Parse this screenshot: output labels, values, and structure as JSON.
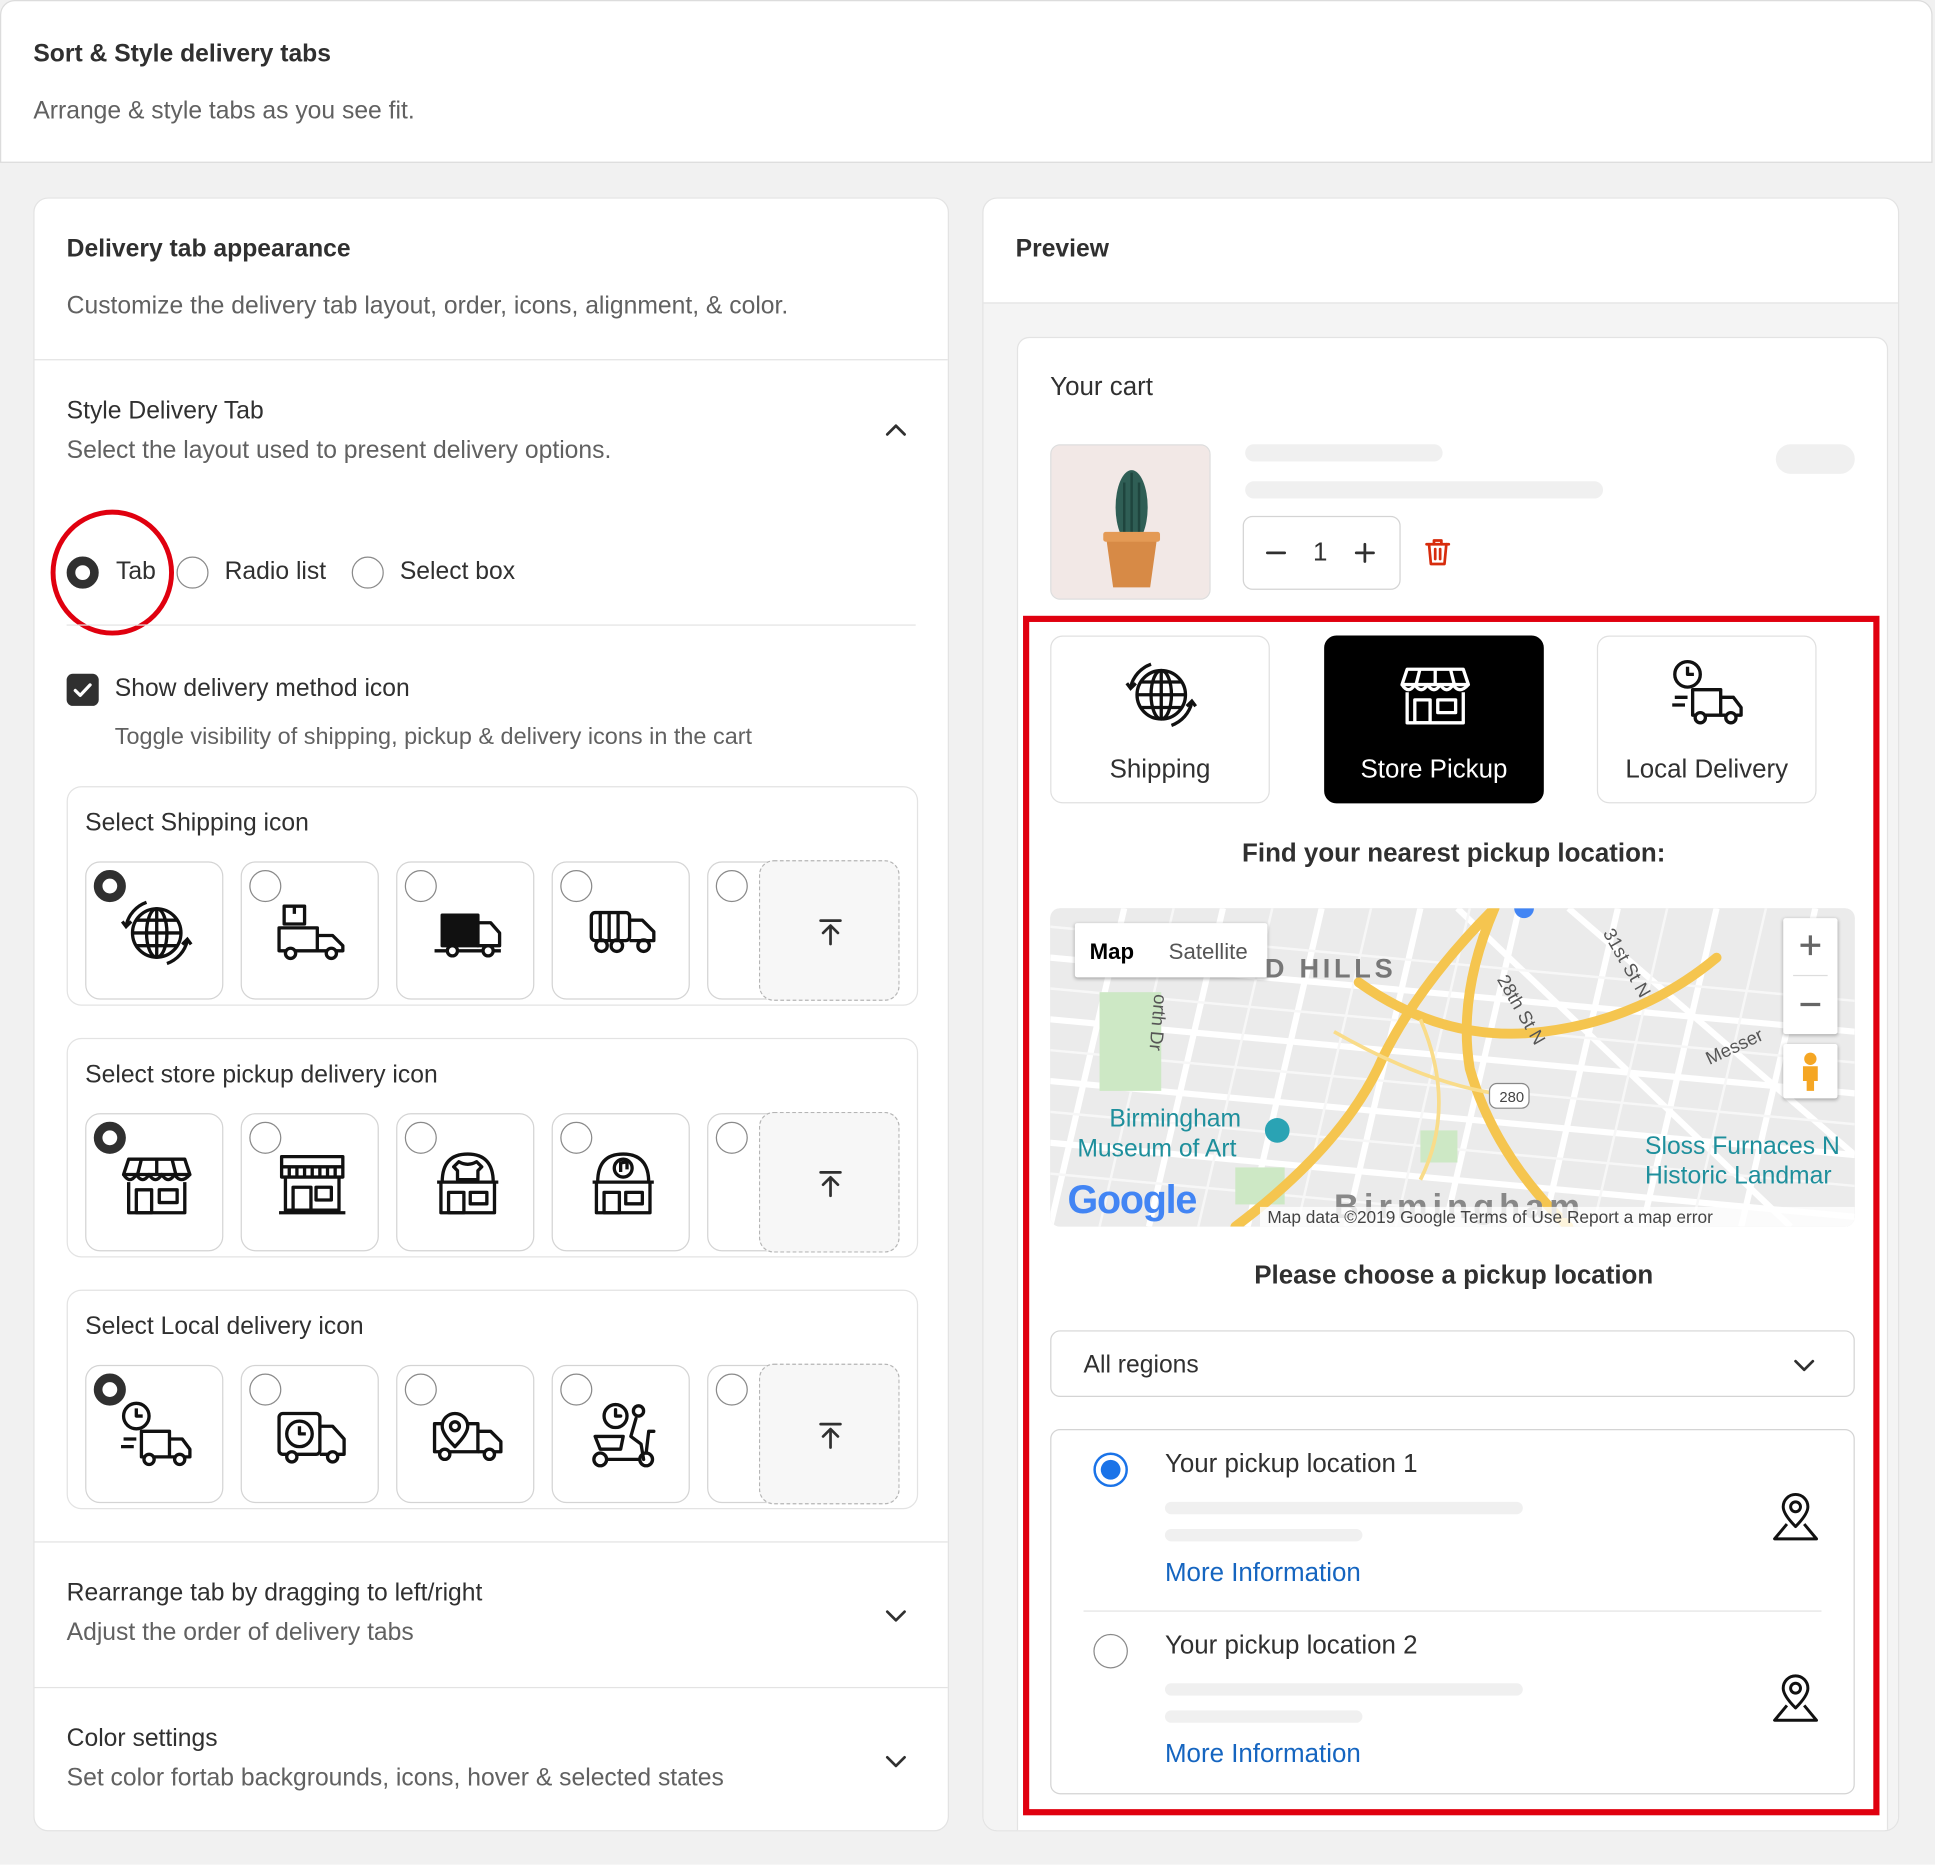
{
  "header": {
    "title": "Sort & Style delivery tabs",
    "subtitle": "Arrange & style tabs as you see fit."
  },
  "appearance": {
    "title": "Delivery tab appearance",
    "description": "Customize the delivery tab layout, order, icons, alignment, & color."
  },
  "style_tab": {
    "title": "Style Delivery Tab",
    "description": "Select the layout used to present delivery options.",
    "options": [
      "Tab",
      "Radio list",
      "Select box"
    ],
    "selected": "Tab"
  },
  "show_icon": {
    "label": "Show delivery method icon",
    "help": "Toggle visibility of shipping, pickup & delivery icons in the cart",
    "checked": true
  },
  "icon_groups": [
    {
      "title": "Select Shipping icon",
      "icons": [
        "globe-arrows-icon",
        "truck-package-icon",
        "delivery-truck-icon",
        "cargo-truck-icon"
      ],
      "selected_index": 0
    },
    {
      "title": "Select store pickup delivery icon",
      "icons": [
        "storefront-icon",
        "market-stall-icon",
        "clothing-store-icon",
        "music-store-icon"
      ],
      "selected_index": 0
    },
    {
      "title": "Select Local delivery icon",
      "icons": [
        "clock-truck-icon",
        "clock-van-icon",
        "location-truck-icon",
        "scooter-courier-icon"
      ],
      "selected_index": 0
    }
  ],
  "rearrange": {
    "title": "Rearrange tab by dragging to left/right",
    "description": "Adjust the order of delivery tabs"
  },
  "color_settings": {
    "title": "Color settings",
    "description": "Set color fortab backgrounds, icons, hover & selected states"
  },
  "preview": {
    "title": "Preview",
    "cart_title": "Your cart",
    "quantity": "1",
    "tabs": [
      {
        "label": "Shipping",
        "icon": "globe-arrows-icon"
      },
      {
        "label": "Store Pickup",
        "icon": "storefront-icon"
      },
      {
        "label": "Local Delivery",
        "icon": "clock-truck-icon"
      }
    ],
    "selected_tab": "Store Pickup",
    "find_heading": "Find your nearest pickup location:",
    "map": {
      "type_map": "Map",
      "type_satellite": "Satellite",
      "labels": {
        "hills": "D HILLS",
        "street_28": "28th St N",
        "street_31": "31st St N",
        "street_north": "orth Dr",
        "messer": "Messer",
        "shield": "280",
        "museum1": "Birmingham",
        "museum2": "Museum of Art",
        "sloss1": "Sloss Furnaces N",
        "sloss2": "Historic Landmar",
        "city": "Birmingham",
        "google": "Google",
        "footer": "Map data ©2019 Google   Terms of Use   Report a map error"
      }
    },
    "choose_heading": "Please choose a pickup location",
    "region_select": "All regions",
    "locations": [
      {
        "name": "Your pickup location 1",
        "link": "More Information",
        "selected": true
      },
      {
        "name": "Your pickup location 2",
        "link": "More Information",
        "selected": false
      }
    ]
  },
  "colors": {
    "accent_red": "#e0000f",
    "link_blue": "#1565c0",
    "radio_blue": "#1a73e8",
    "delete_red": "#d72c0d"
  }
}
